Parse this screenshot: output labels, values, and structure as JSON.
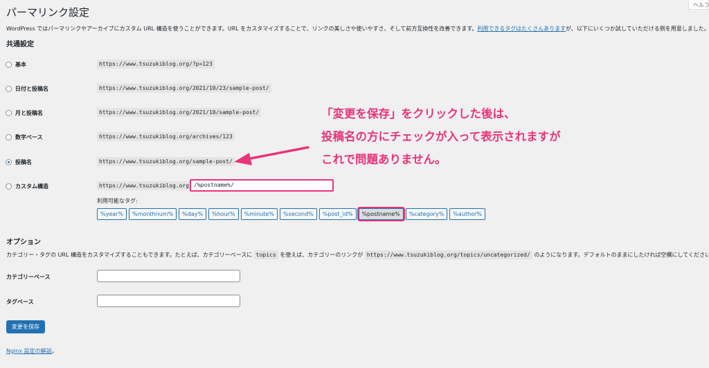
{
  "page": {
    "help_tab": "ヘルプ",
    "title": "パーマリンク設定",
    "intro_before": "WordPress ではパーマリンクやアーカイブにカスタム URL 構造を使うことができます。URL をカスタマイズすることで、リンクの美しさや使いやすさ、そして前方互換性を改善できます。",
    "intro_link": "利用できるタグはたくさんあります",
    "intro_after": "が、以下にいくつか試していただける例を用意しました。"
  },
  "common": {
    "heading": "共通設定",
    "options": [
      {
        "label": "基本",
        "example": "https://www.tsuzukiblog.org/?p=123",
        "checked": false
      },
      {
        "label": "日付と投稿名",
        "example": "https://www.tsuzukiblog.org/2021/10/23/sample-post/",
        "checked": false
      },
      {
        "label": "月と投稿名",
        "example": "https://www.tsuzukiblog.org/2021/10/sample-post/",
        "checked": false
      },
      {
        "label": "数字ベース",
        "example": "https://www.tsuzukiblog.org/archives/123",
        "checked": false
      },
      {
        "label": "投稿名",
        "example": "https://www.tsuzukiblog.org/sample-post/",
        "checked": true
      }
    ],
    "custom": {
      "label": "カスタム構造",
      "base": "https://www.tsuzukiblog.org",
      "value": "/%postname%/",
      "tags_label": "利用可能なタグ:",
      "tags": [
        "%year%",
        "%monthnum%",
        "%day%",
        "%hour%",
        "%minute%",
        "%second%",
        "%post_id%",
        "%postname%",
        "%category%",
        "%author%"
      ],
      "active_tag": "%postname%"
    }
  },
  "options_section": {
    "heading": "オプション",
    "desc_1": "カテゴリー・タグの URL 構造をカスタマイズすることもできます。たとえば、カテゴリーベースに",
    "desc_code_1": "topics",
    "desc_2": "を使えば、カテゴリーのリンクが",
    "desc_code_2": "https://www.tsuzukiblog.org/topics/uncategorized/",
    "desc_3": "のようになります。デフォルトのままにしたければ空欄にしてください。",
    "category_base_label": "カテゴリーベース",
    "tag_base_label": "タグベース"
  },
  "save_button": "変更を保存",
  "nginx": {
    "link": "Nginx 設定の解説",
    "suffix": "。"
  },
  "annotation": {
    "line1": "「変更を保存」をクリックした後は、",
    "line2": "投稿名の方にチェックが入って表示されますが",
    "line3": "これで問題ありません。"
  },
  "colors": {
    "accent": "#2271b1",
    "annotation": "#e8347a"
  }
}
